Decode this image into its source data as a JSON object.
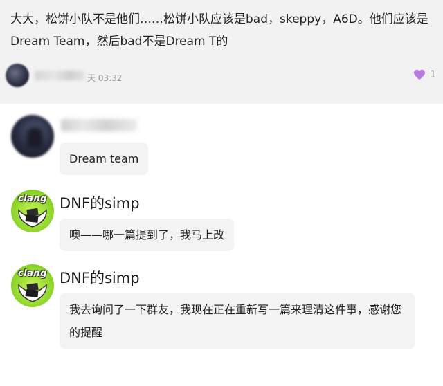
{
  "top_comment": {
    "text": "大大，松饼小队不是他们……松饼小队应该是bad，skeppy，A6D。他们应该是Dream Team，然后bad不是Dream T的",
    "time": "天 03:32",
    "likes": "1",
    "like_color": "#b77be0"
  },
  "replies": [
    {
      "username": "",
      "username_blurred": true,
      "avatar": "blurred-avatar",
      "text": "Dream team"
    },
    {
      "username": "DNF的simp",
      "avatar_text": "clang",
      "text": "噢——哪一篇提到了，我马上改"
    },
    {
      "username": "DNF的simp",
      "avatar_text": "clang",
      "text": "我去询问了一下群友，我现在正在重新写一篇来理清这件事，感谢您的提醒"
    }
  ]
}
